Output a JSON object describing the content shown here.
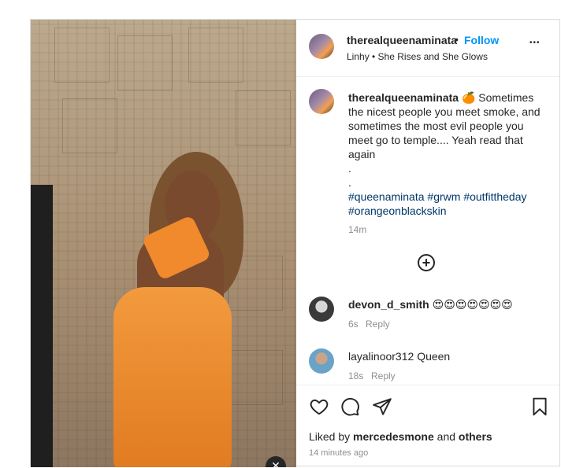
{
  "post": {
    "author": "therealqueenaminata",
    "follow_label": "Follow",
    "separator": "•",
    "audio": "Linhy • She Rises and She Glows",
    "more_label": "•••",
    "caption_emoji": "🍊",
    "caption_text": "Sometimes the nicest people you meet smoke, and sometimes the most evil people you meet go to temple.... Yeah read that again",
    "caption_dots": [
      ".",
      "."
    ],
    "hashtags": [
      "#queenaminata",
      "#grwm",
      "#outfittheday",
      "#orangeonblackskin"
    ],
    "caption_time": "14m",
    "load_more_label": "+",
    "close_label": "✕"
  },
  "comments": [
    {
      "user": "devon_d_smith",
      "text": "😍😍😍😍😍😍😍",
      "time": "6s",
      "reply_label": "Reply"
    },
    {
      "user": "layalinoor312",
      "text": "Queen",
      "time": "18s",
      "reply_label": "Reply"
    }
  ],
  "actions": {
    "like_icon": "heart-icon",
    "comment_icon": "comment-icon",
    "share_icon": "paper-plane-icon",
    "save_icon": "bookmark-icon"
  },
  "likes": {
    "prefix": "Liked by",
    "user": "mercedesmone",
    "and": "and",
    "others": "others"
  },
  "posted_ago": "14 minutes ago"
}
